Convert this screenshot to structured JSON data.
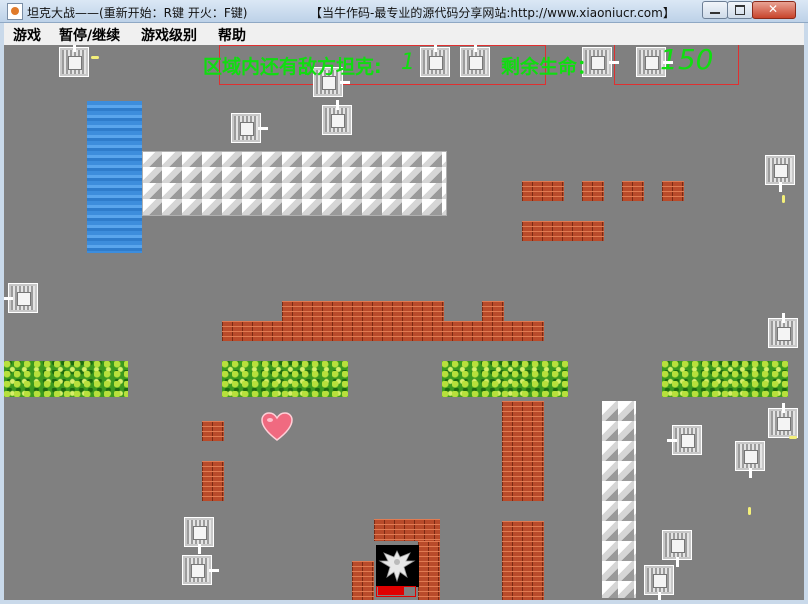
{
  "window": {
    "title": "坦克大战——(重新开始：R键  开火：F键)",
    "site": "【当牛作码-最专业的源代码分享网站:http://www.xiaoniucr.com】",
    "minimize_icon": "minimize-icon",
    "maximize_icon": "maximize-icon",
    "close_icon": "close-icon"
  },
  "menu": {
    "items": [
      "游戏",
      "暂停/继续",
      "游戏级别",
      "帮助"
    ]
  },
  "hud": {
    "enemies_label": "区域内还有敌方坦克:",
    "enemies_count": "1",
    "lives_label": "剩余生命：",
    "lives_value": "150",
    "text_color": "#10dd10",
    "box_color": "#e03030"
  },
  "map": {
    "background_color": "#808080",
    "tile_types": [
      "water",
      "iron-wall",
      "brick-wall",
      "grass"
    ],
    "pickups": [
      "heart-icon"
    ],
    "base": "eagle-icon"
  }
}
